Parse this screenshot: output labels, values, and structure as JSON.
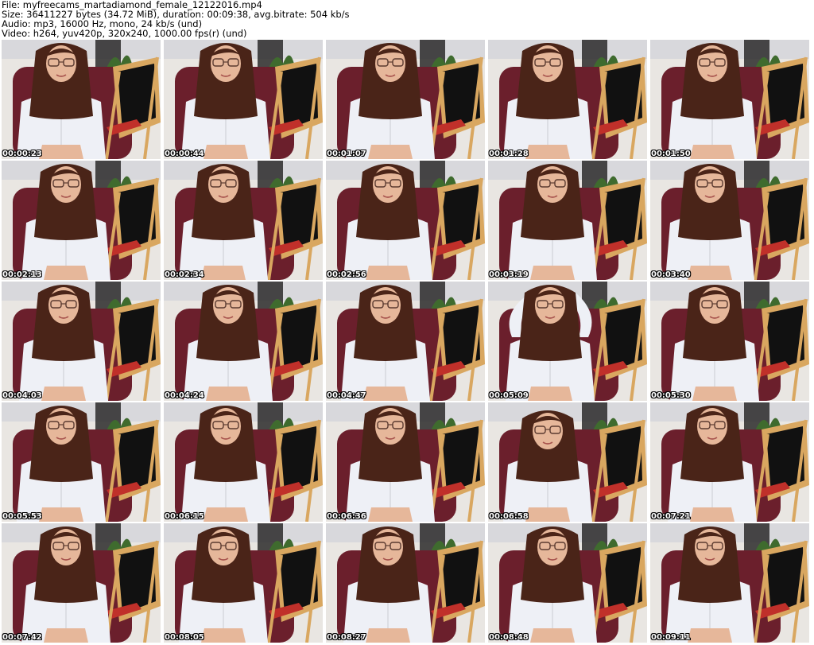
{
  "info": {
    "file": "File: myfreecams_martadiamond_female_12122016.mp4",
    "size": "Size: 36411227 bytes (34.72 MiB), duration: 00:09:38, avg.bitrate: 504 kb/s",
    "audio": "Audio: mp3, 16000 Hz, mono, 24 kb/s (und)",
    "video": "Video: h264, yuv420p, 320x240, 1000.00 fps(r) (und)"
  },
  "frames": [
    {
      "time": "00:00:23",
      "pose": "normal"
    },
    {
      "time": "00:00:44",
      "pose": "normal"
    },
    {
      "time": "00:01:07",
      "pose": "normal"
    },
    {
      "time": "00:01:28",
      "pose": "normal"
    },
    {
      "time": "00:01:50",
      "pose": "normal"
    },
    {
      "time": "00:02:13",
      "pose": "normal"
    },
    {
      "time": "00:02:34",
      "pose": "normal"
    },
    {
      "time": "00:02:56",
      "pose": "normal"
    },
    {
      "time": "00:03:19",
      "pose": "normal"
    },
    {
      "time": "00:03:40",
      "pose": "normal"
    },
    {
      "time": "00:04:03",
      "pose": "normal"
    },
    {
      "time": "00:04:24",
      "pose": "normal"
    },
    {
      "time": "00:04:47",
      "pose": "normal"
    },
    {
      "time": "00:05:09",
      "pose": "arms-up"
    },
    {
      "time": "00:05:30",
      "pose": "normal"
    },
    {
      "time": "00:05:53",
      "pose": "normal"
    },
    {
      "time": "00:06:15",
      "pose": "normal"
    },
    {
      "time": "00:06:36",
      "pose": "normal"
    },
    {
      "time": "00:06:58",
      "pose": "head-down"
    },
    {
      "time": "00:07:21",
      "pose": "normal"
    },
    {
      "time": "00:07:42",
      "pose": "normal"
    },
    {
      "time": "00:08:05",
      "pose": "normal"
    },
    {
      "time": "00:08:27",
      "pose": "normal"
    },
    {
      "time": "00:08:48",
      "pose": "normal"
    },
    {
      "time": "00:09:11",
      "pose": "normal"
    }
  ],
  "colors": {
    "wall": "#e9e6e2",
    "chair": "#6b1f2c",
    "board": "#111111",
    "easel": "#d9a760",
    "shelf": "#2b2a2a",
    "shirt": "#eef0f6",
    "skin": "#e6b79a",
    "hair": "#4a2418",
    "glasses": "#5a3a30"
  }
}
